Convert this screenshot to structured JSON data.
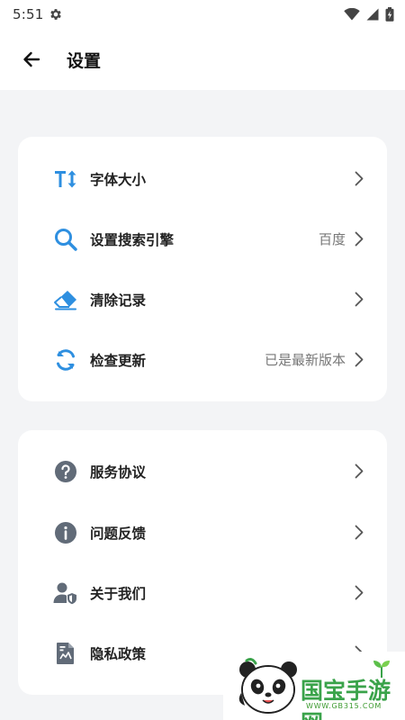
{
  "status_bar": {
    "time": "5:51",
    "icons": [
      "gear-icon",
      "wifi-icon",
      "signal-icon",
      "battery-icon"
    ]
  },
  "header": {
    "title": "设置",
    "back_icon": "arrow-left-icon"
  },
  "groups": [
    {
      "items": [
        {
          "label": "字体大小",
          "icon": "text-size-icon",
          "value": ""
        },
        {
          "label": "设置搜索引擎",
          "icon": "search-icon",
          "value": "百度"
        },
        {
          "label": "清除记录",
          "icon": "eraser-icon",
          "value": ""
        },
        {
          "label": "检查更新",
          "icon": "refresh-icon",
          "value": "已是最新版本"
        }
      ]
    },
    {
      "items": [
        {
          "label": "服务协议",
          "icon": "question-circle-icon",
          "value": ""
        },
        {
          "label": "问题反馈",
          "icon": "info-circle-icon",
          "value": ""
        },
        {
          "label": "关于我们",
          "icon": "user-shield-icon",
          "value": ""
        },
        {
          "label": "隐私政策",
          "icon": "document-icon",
          "value": ""
        }
      ]
    }
  ],
  "watermark": {
    "title": "国宝手游网",
    "url": "WWW.GB315.COM"
  },
  "colors": {
    "accent_blue": "#2e8fe0",
    "icon_gray": "#616b78",
    "background": "#f3f4f6",
    "watermark_green": "#3aa34a"
  }
}
